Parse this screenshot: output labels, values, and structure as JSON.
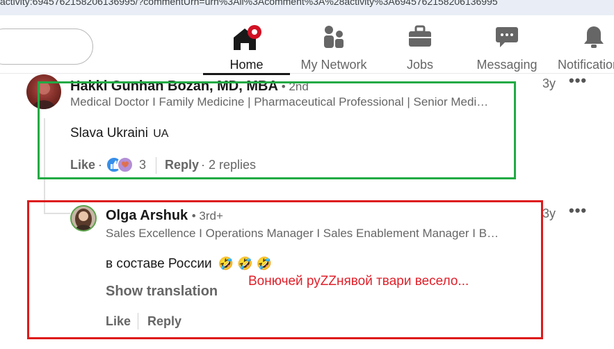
{
  "browser": {
    "url_fragment": "activity:6945762158206136995/?commentUrn=urn%3Ali%3Acomment%3A%28activity%3A6945762158206136995"
  },
  "nav": {
    "items": [
      {
        "label": "Home",
        "icon": "home-icon",
        "active": true
      },
      {
        "label": "My Network",
        "icon": "network-icon"
      },
      {
        "label": "Jobs",
        "icon": "briefcase-icon"
      },
      {
        "label": "Messaging",
        "icon": "messaging-icon"
      },
      {
        "label": "Notifications",
        "icon": "bell-icon"
      }
    ]
  },
  "comments": [
    {
      "name": "Hakki Gunhan Bozan, MD, MBA",
      "degree": "• 2nd",
      "headline": "Medical Doctor I Family Medicine | Pharmaceutical Professional | Senior Medi…",
      "time": "3y",
      "text": "Slava Ukraini",
      "flag": "UA",
      "like": "Like",
      "reaction_count": "3",
      "reply": "Reply",
      "replies": "· 2 replies"
    },
    {
      "name": "Olga Arshuk",
      "degree": "• 3rd+",
      "headline": "Sales Excellence I Operations Manager I Sales Enablement Manager I B…",
      "time": "3y",
      "text": "в составе России",
      "emojis": "🤣 🤣 🤣",
      "show_translation": "Show translation",
      "like": "Like",
      "reply": "Reply"
    }
  ],
  "annotation": "Вонючей руZZнявой твари весело...",
  "colors": {
    "green_box": "#22aa44",
    "red_box": "#dd1a1a",
    "annotation": "#e0202a"
  }
}
